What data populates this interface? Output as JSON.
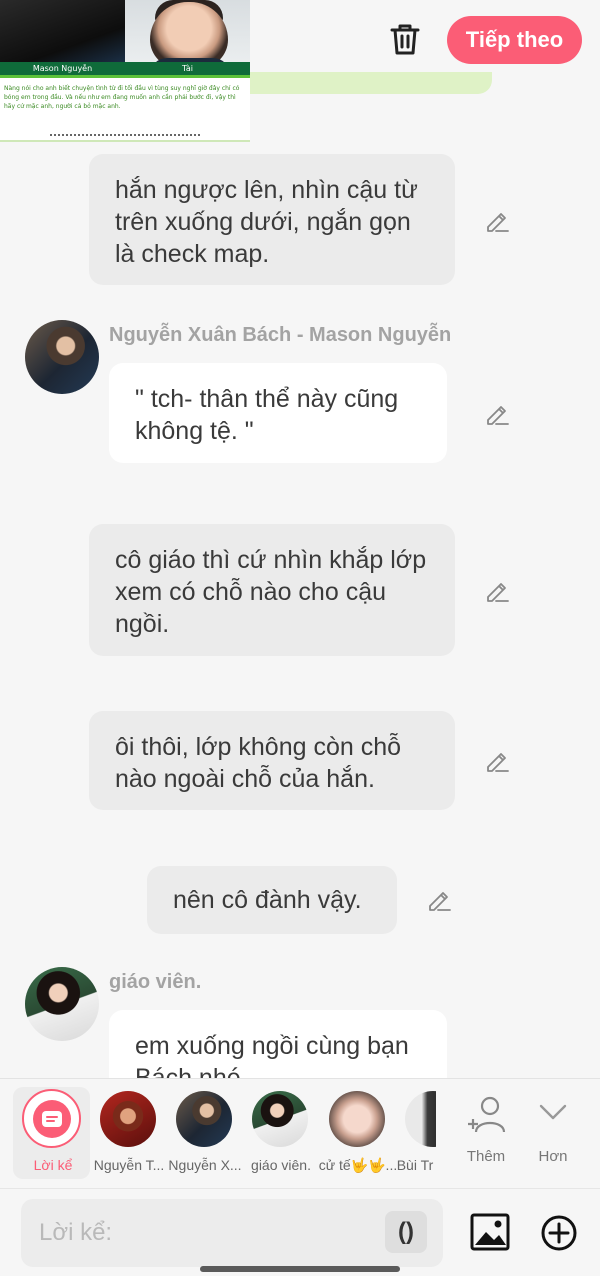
{
  "header": {
    "next_label": "Tiếp theo"
  },
  "banner": {
    "left_caption": "Mason Nguyễn",
    "right_caption": "Tài",
    "tiny_text": "Nàng nói cho anh biết chuyện tình từ đi tối đầu vì tùng suy nghĩ giờ đây chỉ có bóng em trong đầu. Và nếu như em đang muốn anh cần phải bước đi, vậy thì hãy cứ mặc anh, người cả bỏ mặc anh."
  },
  "messages": [
    {
      "type": "narration",
      "text": "hắn ngược lên, nhìn cậu từ trên xuống dưới, ngắn gọn là check map."
    },
    {
      "type": "character",
      "speaker": "Nguyễn Xuân Bách - Mason Nguyễn",
      "text": "\" tch- thân thể này cũng không tệ. \""
    },
    {
      "type": "narration",
      "text": "cô giáo thì cứ nhìn khắp lớp xem có chỗ nào cho cậu ngồi."
    },
    {
      "type": "narration",
      "text": "ôi thôi, lớp không còn chỗ nào ngoài chỗ của hắn."
    },
    {
      "type": "narration",
      "text": "nên cô đành vậy."
    },
    {
      "type": "character",
      "speaker": "giáo viên.",
      "text": "em xuống ngồi cùng bạn Bách nhé."
    }
  ],
  "cast": {
    "items": [
      {
        "label": "Lời kể",
        "icon": "narration-icon",
        "selected": true
      },
      {
        "label": "Nguyễn T...",
        "icon": "avatar"
      },
      {
        "label": "Nguyễn X...",
        "icon": "avatar"
      },
      {
        "label": "giáo viên.",
        "icon": "avatar"
      },
      {
        "label": "cử tế🤟🤟...",
        "icon": "avatar"
      },
      {
        "label": "Bùi Tr",
        "icon": "avatar"
      }
    ],
    "add_label": "Thêm",
    "more_label": "Hơn"
  },
  "composer": {
    "placeholder": "Lời kể:",
    "paren_label": "()"
  },
  "colors": {
    "accent": "#fb5d76",
    "narration_bubble": "#ebebeb",
    "character_bubble": "#ffffff",
    "background": "#f6f6f6"
  }
}
